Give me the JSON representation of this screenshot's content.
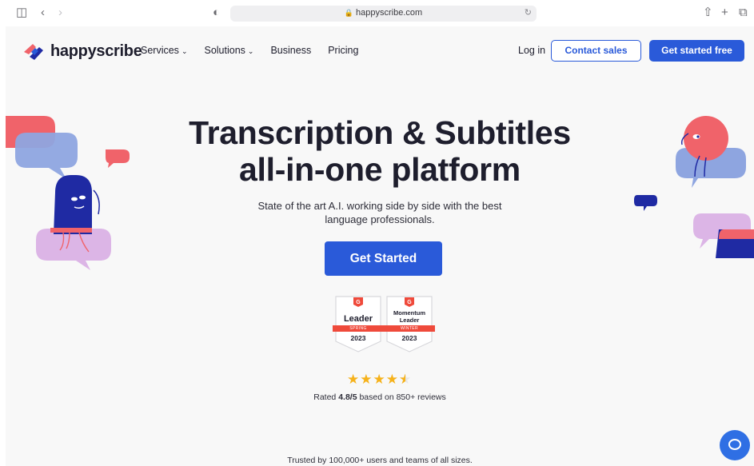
{
  "browser": {
    "url": "happyscribe.com"
  },
  "nav": {
    "brand": "happyscribe",
    "links": [
      {
        "label": "Services",
        "dropdown": true
      },
      {
        "label": "Solutions",
        "dropdown": true
      },
      {
        "label": "Business",
        "dropdown": false
      },
      {
        "label": "Pricing",
        "dropdown": false
      }
    ],
    "login": "Log in",
    "contact_sales": "Contact sales",
    "get_started_free": "Get started free"
  },
  "hero": {
    "title_line1": "Transcription & Subtitles",
    "title_line2": "all-in-one platform",
    "subtitle": "State of the art A.I. working side by side with the best language professionals.",
    "cta": "Get Started"
  },
  "badges": [
    {
      "title": "Leader",
      "season": "SPRING",
      "year": "2023"
    },
    {
      "title": "Momentum Leader",
      "season": "WINTER",
      "year": "2023"
    }
  ],
  "rating": {
    "stars": 4.5,
    "prefix": "Rated ",
    "score": "4.8/5",
    "suffix": " based on 850+ reviews"
  },
  "trusted": "Trusted by 100,000+ users and teams of all sizes.",
  "colors": {
    "primary": "#2a5ad9",
    "coral": "#f0636a",
    "navy": "#1f2aa3",
    "lavender": "#dcb5e6",
    "periwinkle": "#8ea5e0",
    "star": "#f6b21b"
  }
}
